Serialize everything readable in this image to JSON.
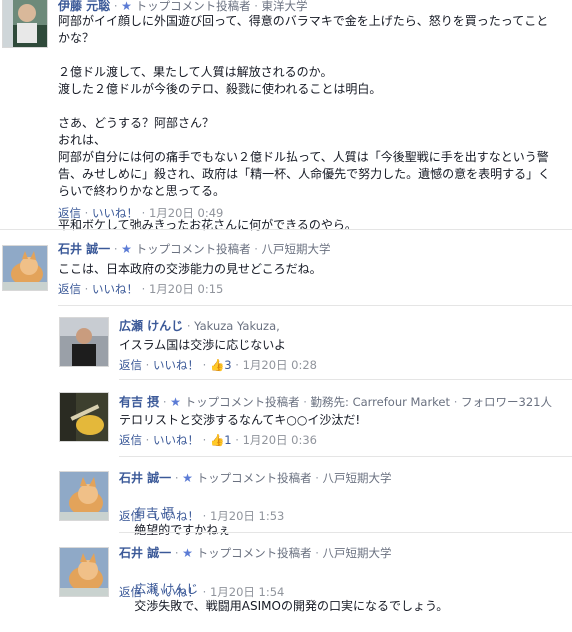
{
  "comments": [
    {
      "name": "伊藤 元聡",
      "badge": "トップコメント投稿者",
      "affiliation": "東洋大学",
      "body": "阿部がイイ顔しに外国遊び回って、得意のバラマキで金を上げたら、怒りを買ったってことかな？\n\n２億ドル渡して、果たして人質は解放されるのか。\n渡した２億ドルが今後のテロ、殺戮に使われることは明白。\n\nさあ、どうする？阿部さん？\nおれは、\n阿部が自分には何の痛手でもない２億ドル払って、人質は「今後聖戦に手を出すなという警告、みせしめに」殺され、政府は「精一杯、人命優先で努力した。遺憾の意を表明する」くらいで終わりかなと思ってる。\n\n平和ボケして弛みきったお花さんに何ができるのやら。",
      "reply": "返信",
      "like": "いいね！",
      "time": "1月20日 0:49"
    },
    {
      "name": "石井 誠一",
      "badge": "トップコメント投稿者",
      "affiliation": "八戸短期大学",
      "body": "ここは、日本政府の交渉能力の見せどころだね。",
      "reply": "返信",
      "like": "いいね！",
      "time": "1月20日 0:15"
    },
    {
      "name": "広瀬 けんじ",
      "affiliation": "Yakuza Yakuza,",
      "body": "イスラム国は交渉に応じないよ",
      "reply": "返信",
      "like": "いいね！",
      "likes_count": "3",
      "time": "1月20日 0:28"
    },
    {
      "name": "有吉 摂",
      "badge": "トップコメント投稿者",
      "affiliation": "勤務先: Carrefour Market",
      "followers": "フォロワー321人",
      "body": "テロリストと交渉するなんてキ○○イ沙汰だ!",
      "reply": "返信",
      "like": "いいね！",
      "likes_count": "1",
      "time": "1月20日 0:36"
    },
    {
      "name": "石井 誠一",
      "badge": "トップコメント投稿者",
      "affiliation": "八戸短期大学",
      "mention": "有吉 摂",
      "body": "絶望的ですかねぇ",
      "reply": "返信",
      "like": "いいね！",
      "time": "1月20日 1:53"
    },
    {
      "name": "石井 誠一",
      "badge": "トップコメント投稿者",
      "affiliation": "八戸短期大学",
      "mention": "広瀬 けんじ",
      "body": "交渉失敗で、戦闘用ASIMOの開発の口実になるでしょう。",
      "reply": "返信",
      "like": "いいね！",
      "time": "1月20日 1:54"
    }
  ],
  "symbols": {
    "star": "★",
    "separator": "·",
    "thumb_icon": "thumbs-up-icon"
  },
  "colors": {
    "link": "#3b5998",
    "text": "#141823",
    "muted": "#90949c",
    "star": "#5b7bd5"
  }
}
